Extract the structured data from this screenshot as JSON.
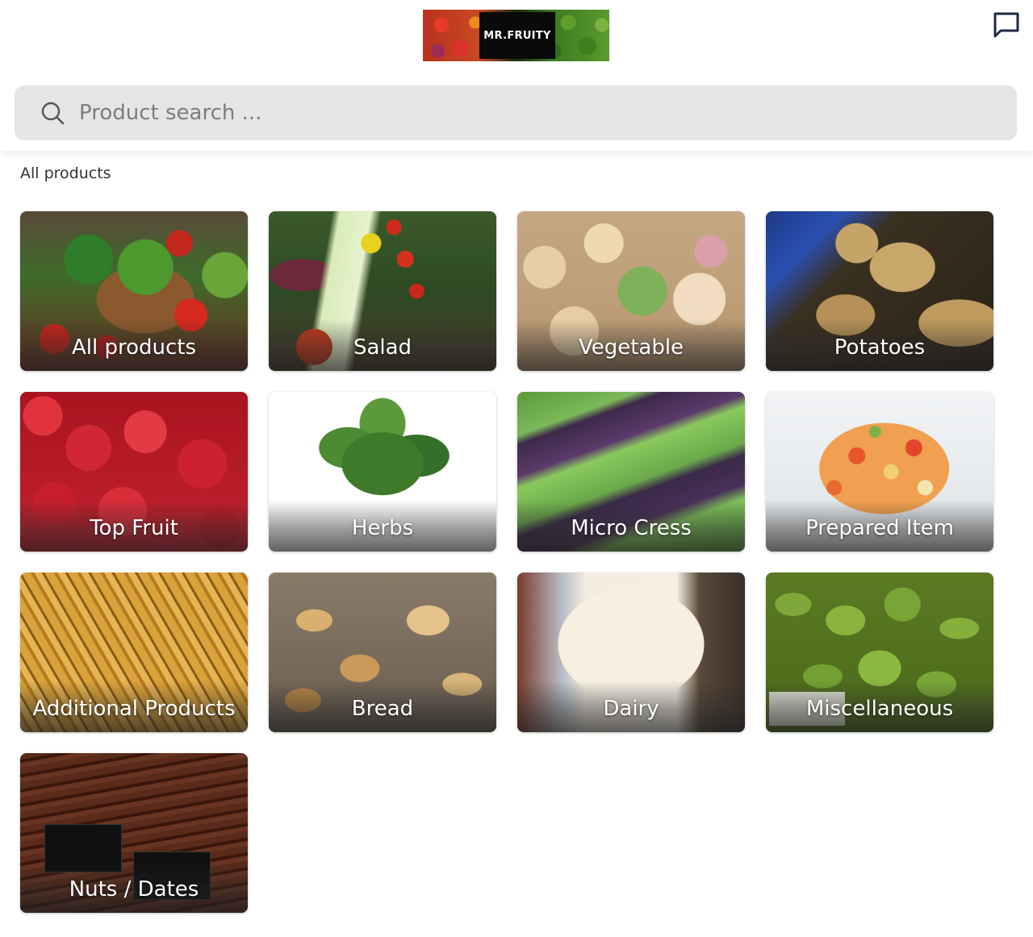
{
  "header": {
    "logo_text": "MR.FRUITY",
    "search": {
      "placeholder": "Product search ..."
    }
  },
  "icons": {
    "chat": "chat-bubble-icon",
    "search": "search-icon"
  },
  "section_title": "All products",
  "categories": [
    {
      "label": "All products"
    },
    {
      "label": "Salad"
    },
    {
      "label": "Vegetable"
    },
    {
      "label": "Potatoes"
    },
    {
      "label": "Top Fruit"
    },
    {
      "label": "Herbs"
    },
    {
      "label": "Micro Cress"
    },
    {
      "label": "Prepared Item"
    },
    {
      "label": "Additional Products"
    },
    {
      "label": "Bread"
    },
    {
      "label": "Dairy"
    },
    {
      "label": "Miscellaneous"
    },
    {
      "label": "Nuts / Dates"
    }
  ],
  "colors": {
    "search_background": "#e5e5e5",
    "label_text": "#ffffff",
    "icon_stroke": "#1f2a44"
  }
}
